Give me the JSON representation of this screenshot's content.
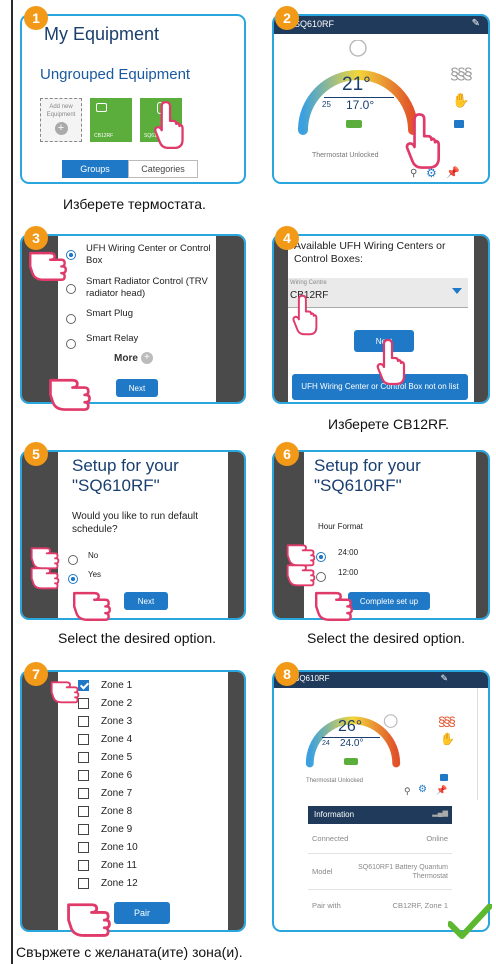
{
  "steps": [
    "1",
    "2",
    "3",
    "4",
    "5",
    "6",
    "7",
    "8"
  ],
  "p1": {
    "title": "My Equipment",
    "subtitle": "Ungrouped Equipment",
    "add_new": "Add new Equipment",
    "tile1": "CB12RF",
    "tile2": "SQ610RF",
    "tab_groups": "Groups",
    "tab_categories": "Categories"
  },
  "p2": {
    "device": "SQ610RF",
    "temp": "21°",
    "low": "25",
    "set": "17.0°",
    "eco": "ECO",
    "status": "Thermostat Unlocked"
  },
  "p3": {
    "options": [
      "UFH Wiring Center or Control Box",
      "Smart Radiator Control (TRV radiator head)",
      "Smart Plug",
      "Smart Relay"
    ],
    "more": "More",
    "next": "Next"
  },
  "p4": {
    "heading": "Available UFH Wiring Centers or Control Boxes:",
    "field_label": "Wiring Centre",
    "field_value": "CB12RF",
    "next": "Next",
    "not_on_list": "UFH Wiring Center or Control Box not on list"
  },
  "p5": {
    "title": "Setup for your \"SQ610RF\"",
    "question": "Would you like to run default schedule?",
    "no": "No",
    "yes": "Yes",
    "next": "Next"
  },
  "p6": {
    "title": "Setup for your \"SQ610RF\"",
    "label": "Hour Format",
    "opt1": "24:00",
    "opt2": "12:00",
    "button": "Complete set up"
  },
  "p7": {
    "zones": [
      "Zone 1",
      "Zone 2",
      "Zone 3",
      "Zone 4",
      "Zone 5",
      "Zone 6",
      "Zone 7",
      "Zone 8",
      "Zone 9",
      "Zone 10",
      "Zone 11",
      "Zone 12"
    ],
    "pair": "Pair"
  },
  "p8": {
    "device": "SQ610RF",
    "temp": "26°",
    "low": "24",
    "set": "24.0°",
    "status": "Thermostat Unlocked",
    "info": "Information",
    "row1_k": "Connected",
    "row1_v": "Online",
    "row2_k": "Model",
    "row2_v": "SQ610RF1 Battery Quantum Thermostat",
    "row3_k": "Pair with",
    "row3_v": "CB12RF, Zone 1"
  },
  "captions": {
    "c2": "Изберете термостата.",
    "c4": "Изберете CB12RF.",
    "c5": "Select the desired option.",
    "c6": "Select the desired option.",
    "c7": "Свържете с желаната(ите) зона(и)."
  }
}
